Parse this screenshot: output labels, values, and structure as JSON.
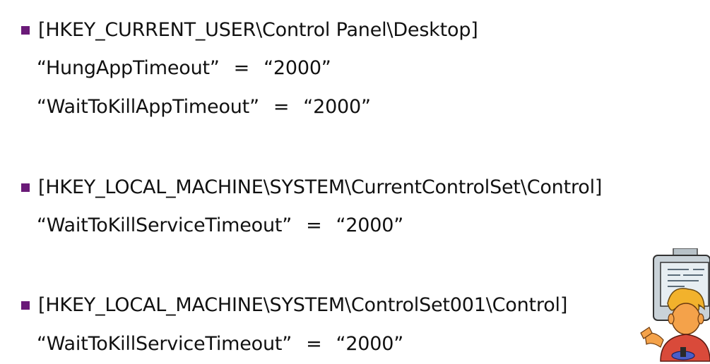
{
  "entries": [
    {
      "key": "[HKEY_CURRENT_USER\\Control Panel\\Desktop]",
      "values": [
        {
          "name": "“HungAppTimeout”",
          "eq": "=",
          "value": "“2000”"
        },
        {
          "name": "“WaitToKillAppTimeout”",
          "eq": "=",
          "value": "“2000”"
        }
      ]
    },
    {
      "key": "[HKEY_LOCAL_MACHINE\\SYSTEM\\CurrentControlSet\\Control]",
      "values": [
        {
          "name": "“WaitToKillServiceTimeout”",
          "eq": "=",
          "value": "“2000”"
        }
      ]
    },
    {
      "key": "[HKEY_LOCAL_MACHINE\\SYSTEM\\ControlSet001\\Control]",
      "values": [
        {
          "name": "“WaitToKillServiceTimeout”",
          "eq": "=",
          "value": "“2000”"
        }
      ]
    }
  ],
  "colors": {
    "bullet": "#6a1a78",
    "text": "#111111"
  },
  "icons": {
    "clipart": "person-at-computer-icon"
  }
}
